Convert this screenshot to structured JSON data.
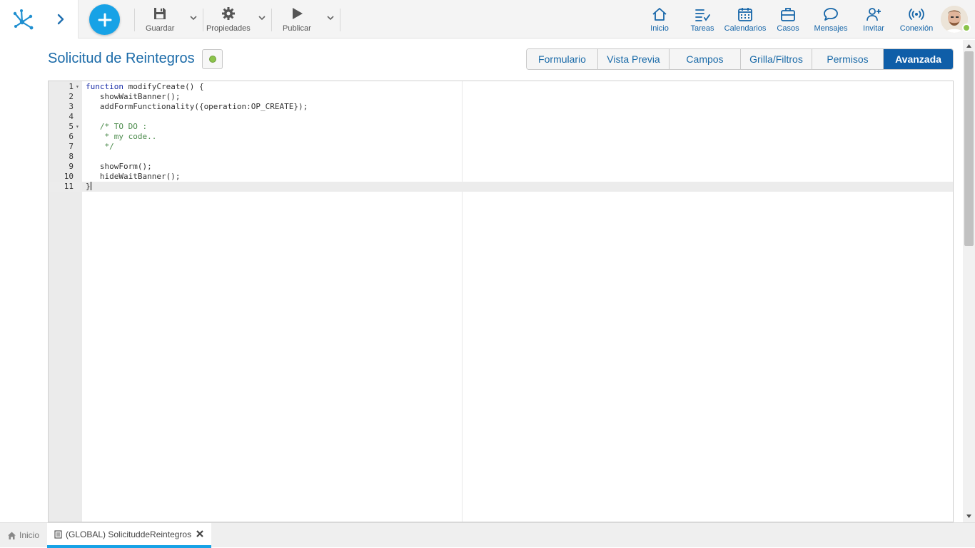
{
  "toolbar": {
    "guardar": "Guardar",
    "propiedades": "Propiedades",
    "publicar": "Publicar"
  },
  "nav": [
    {
      "label": "Inicio",
      "icon": "home-icon"
    },
    {
      "label": "Tareas",
      "icon": "tasks-icon"
    },
    {
      "label": "Calendarios",
      "icon": "calendar-icon"
    },
    {
      "label": "Casos",
      "icon": "briefcase-icon"
    },
    {
      "label": "Mensajes",
      "icon": "chat-icon"
    },
    {
      "label": "Invitar",
      "icon": "invite-user-icon"
    },
    {
      "label": "Conexión",
      "icon": "connection-icon"
    }
  ],
  "page": {
    "title": "Solicitud de Reintegros",
    "status_color": "#8bc34a"
  },
  "tabs": [
    {
      "label": "Formulario",
      "active": false
    },
    {
      "label": "Vista Previa",
      "active": false
    },
    {
      "label": "Campos",
      "active": false
    },
    {
      "label": "Grilla/Filtros",
      "active": false
    },
    {
      "label": "Permisos",
      "active": false
    },
    {
      "label": "Avanzada",
      "active": true
    }
  ],
  "editor": {
    "active_line": 11,
    "lines": [
      {
        "num": "1",
        "fold": true,
        "parts": [
          [
            "kw",
            "function"
          ],
          [
            "",
            "modifyCreate() {"
          ]
        ]
      },
      {
        "num": "2",
        "fold": false,
        "parts": [
          [
            "",
            "   showWaitBanner();"
          ]
        ]
      },
      {
        "num": "3",
        "fold": false,
        "parts": [
          [
            "",
            "   addFormFunctionality({operation:OP_CREATE});"
          ]
        ]
      },
      {
        "num": "4",
        "fold": false,
        "parts": []
      },
      {
        "num": "5",
        "fold": true,
        "parts": [
          [
            "cm",
            "   /* TO DO :"
          ]
        ]
      },
      {
        "num": "6",
        "fold": false,
        "parts": [
          [
            "cm",
            "    * my code.."
          ]
        ]
      },
      {
        "num": "7",
        "fold": false,
        "parts": [
          [
            "cm",
            "    */"
          ]
        ]
      },
      {
        "num": "8",
        "fold": false,
        "parts": []
      },
      {
        "num": "9",
        "fold": false,
        "parts": [
          [
            "",
            "   showForm();"
          ]
        ]
      },
      {
        "num": "10",
        "fold": false,
        "parts": [
          [
            "",
            "   hideWaitBanner();"
          ]
        ]
      },
      {
        "num": "11",
        "fold": false,
        "parts": [
          [
            "",
            "}"
          ]
        ]
      }
    ]
  },
  "bottom": {
    "home_label": "Inicio",
    "doc_label": "(GLOBAL) SolicituddeReintegros"
  },
  "colors": {
    "accent": "#17a2e6",
    "tab_active": "#0f5ea8",
    "link": "#1a6aa8"
  }
}
